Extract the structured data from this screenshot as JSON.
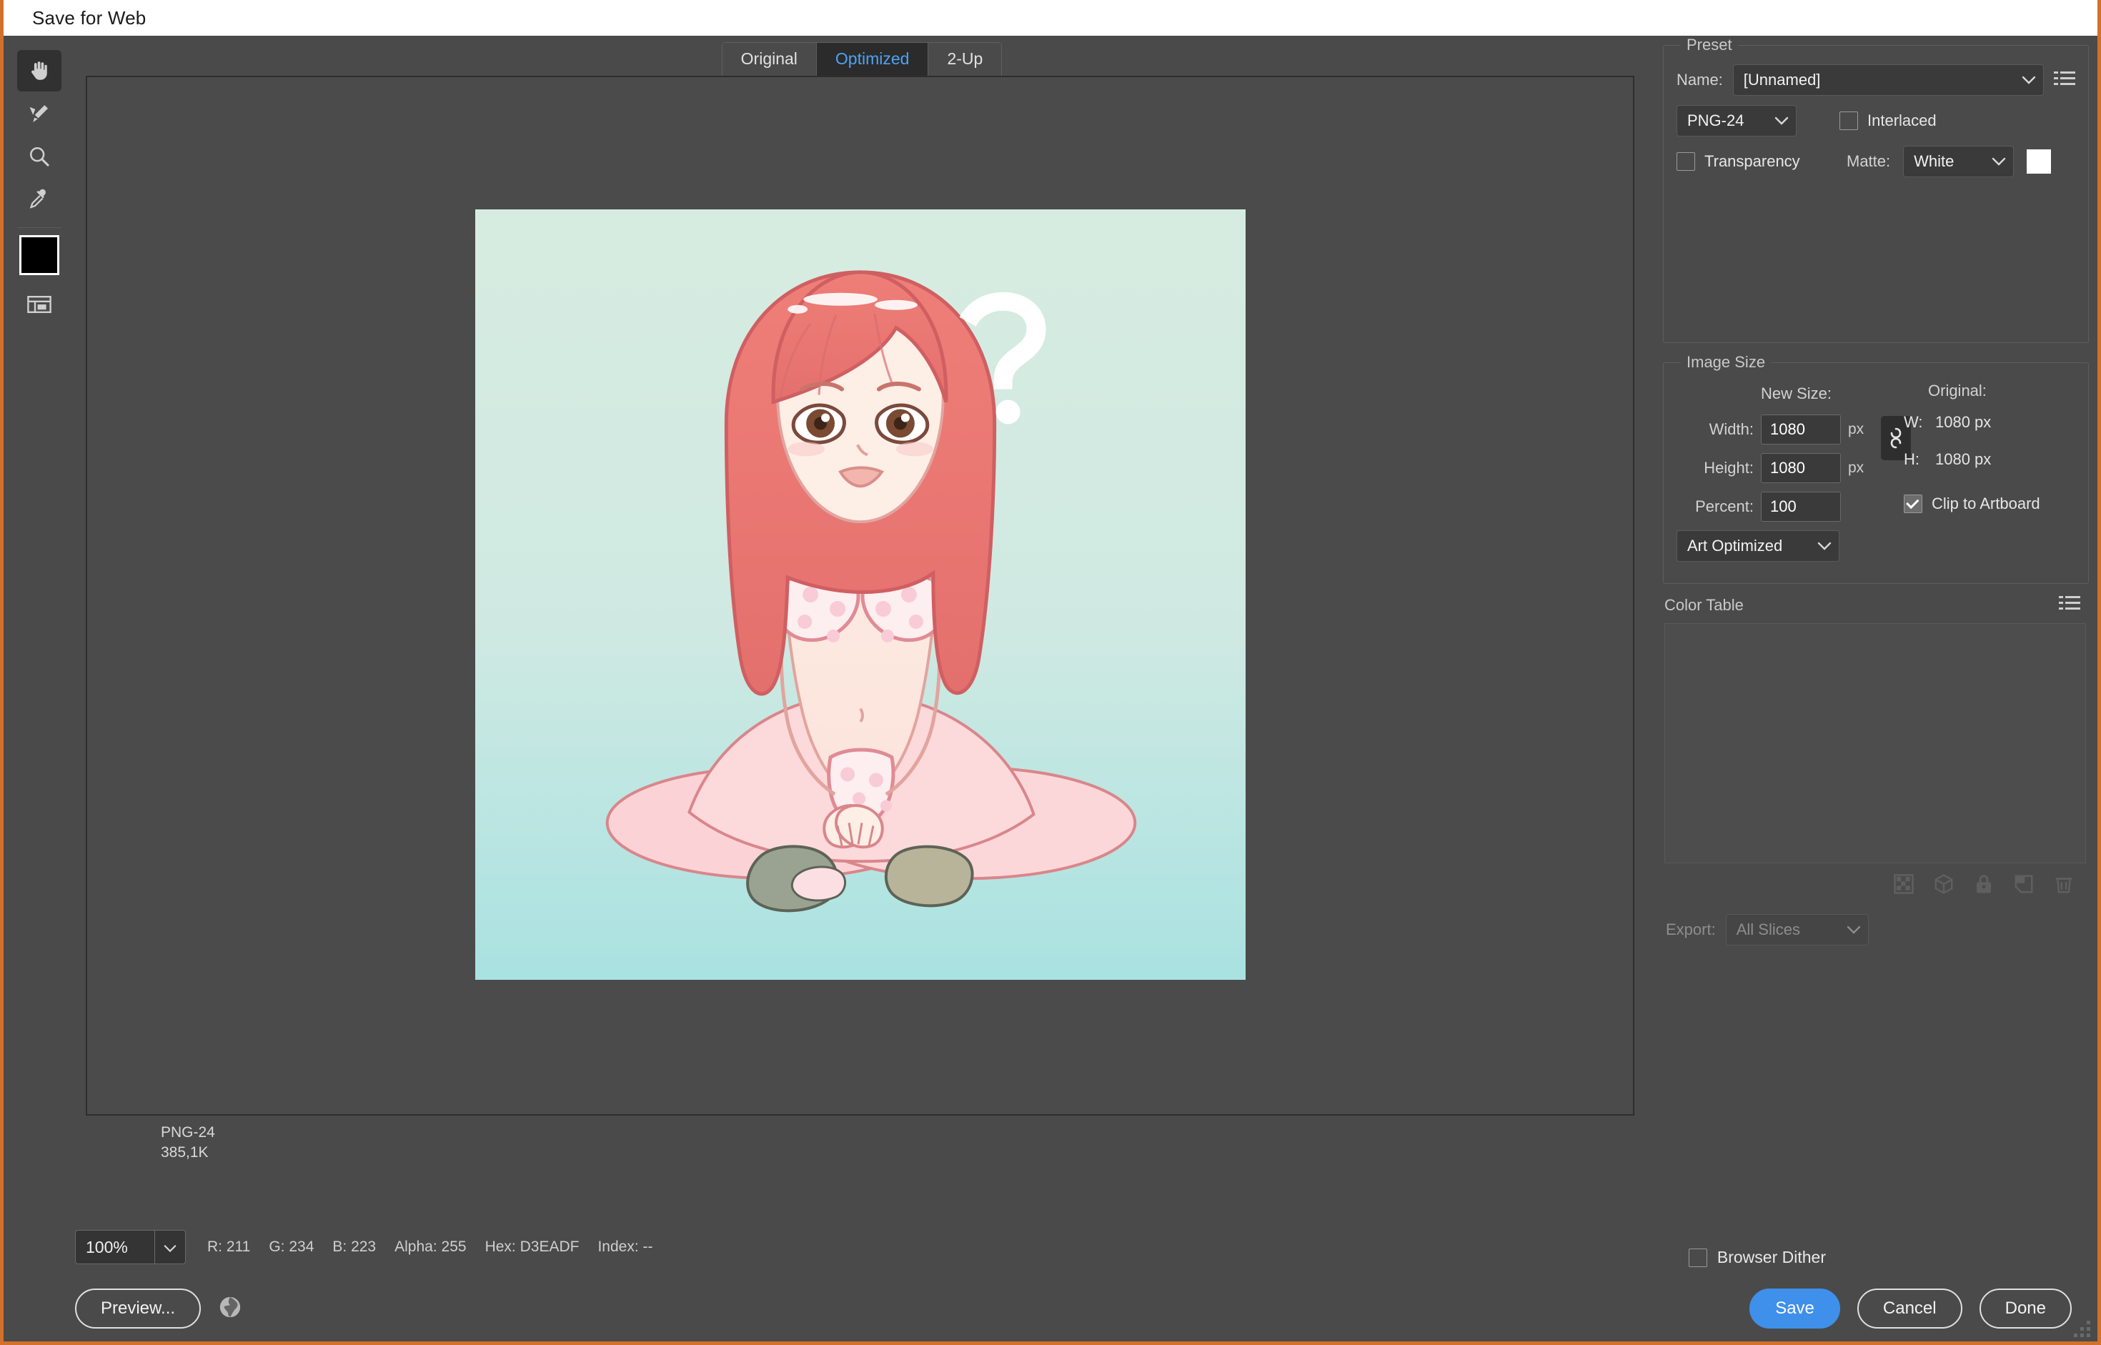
{
  "window": {
    "title": "Save for Web",
    "accent_border": "#d1712a",
    "panel_bg": "#4a4a4a"
  },
  "toolbar": {
    "tools": [
      {
        "name": "hand-tool",
        "label": "Hand Tool",
        "active": true
      },
      {
        "name": "slice-select-tool",
        "label": "Slice Select Tool",
        "active": false
      },
      {
        "name": "zoom-tool",
        "label": "Zoom Tool",
        "active": false
      },
      {
        "name": "eyedropper-tool",
        "label": "Eyedropper Tool",
        "active": false
      }
    ],
    "foreground_swatch": "#000000",
    "toggle_slices_label": "Toggle Slices Visibility"
  },
  "tabs": [
    {
      "label": "Original",
      "active": false
    },
    {
      "label": "Optimized",
      "active": true
    },
    {
      "label": "2-Up",
      "active": false
    }
  ],
  "tab_active_color": "#4da3f5",
  "preview": {
    "artwork_alt": "Illustration of a seated figure with long red hair on a mint-to-aqua gradient background, with a white question mark",
    "background_top": "#d3eadf",
    "background_bottom": "#aee3e0",
    "file_format": "PNG-24",
    "file_size": "385,1K"
  },
  "preset": {
    "group_label": "Preset",
    "name_label": "Name:",
    "name_value": "[Unnamed]",
    "menu_icon": "list-menu-icon",
    "format_value": "PNG-24",
    "interlaced_label": "Interlaced",
    "interlaced_checked": false,
    "transparency_label": "Transparency",
    "transparency_checked": false,
    "matte_label": "Matte:",
    "matte_value": "White",
    "matte_swatch": "#ffffff"
  },
  "image_size": {
    "group_label": "Image Size",
    "new_size_label": "New Size:",
    "width_label": "Width:",
    "width_value": "1080",
    "width_unit": "px",
    "height_label": "Height:",
    "height_value": "1080",
    "height_unit": "px",
    "percent_label": "Percent:",
    "percent_value": "100",
    "quality_value": "Art Optimized",
    "chain_icon": "link-chain-icon",
    "original_label": "Original:",
    "original_w_key": "W:",
    "original_w_value": "1080 px",
    "original_h_key": "H:",
    "original_h_value": "1080 px",
    "clip_label": "Clip to Artboard",
    "clip_checked": true
  },
  "color_table": {
    "title": "Color Table",
    "menu_icon": "list-menu-icon",
    "action_icons": [
      "transparency-checkerboard-icon",
      "web-safe-cube-icon",
      "lock-icon",
      "new-color-icon",
      "trash-icon"
    ],
    "export_label": "Export:",
    "export_value": "All Slices",
    "export_disabled": true
  },
  "status": {
    "zoom_value": "100%",
    "r_label": "R:",
    "r_value": "211",
    "g_label": "G:",
    "g_value": "234",
    "b_label": "B:",
    "b_value": "223",
    "alpha_label": "Alpha:",
    "alpha_value": "255",
    "hex_label": "Hex:",
    "hex_value": "D3EADF",
    "index_label": "Index:",
    "index_value": "--",
    "browser_dither_label": "Browser Dither",
    "browser_dither_checked": false
  },
  "actions": {
    "preview_label": "Preview...",
    "browser_icon": "globe-icon",
    "save_label": "Save",
    "cancel_label": "Cancel",
    "done_label": "Done",
    "save_color": "#3e90ea"
  }
}
